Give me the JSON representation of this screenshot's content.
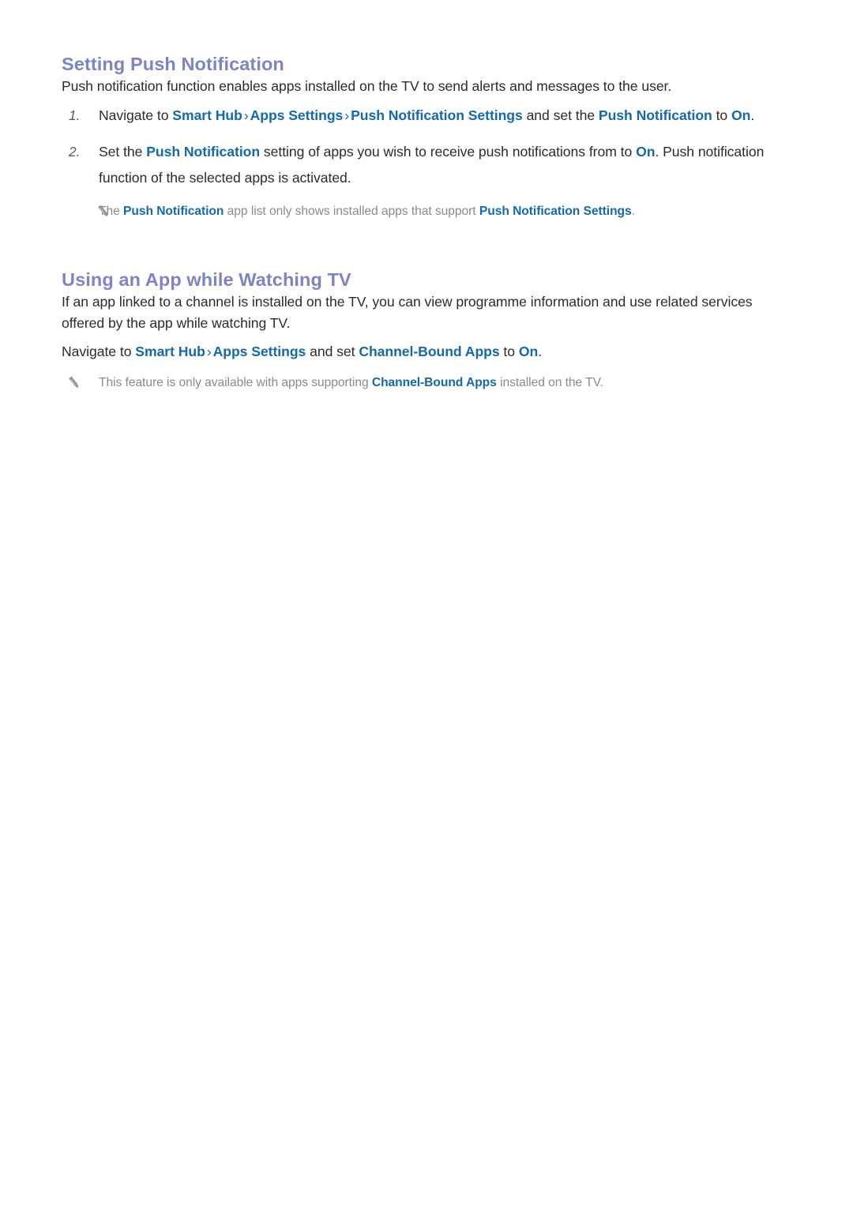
{
  "sections": [
    {
      "id": "setting-push-notification",
      "heading": "Setting Push Notification",
      "intro": "Push notification function enables apps installed on the TV to send alerts and messages to the user.",
      "steps": [
        {
          "marker": "1.",
          "parts": [
            {
              "type": "text",
              "text": "Navigate to "
            },
            {
              "type": "kw",
              "text": "Smart Hub"
            },
            {
              "type": "sep",
              "text": "›"
            },
            {
              "type": "kw",
              "text": "Apps Settings"
            },
            {
              "type": "sep",
              "text": "›"
            },
            {
              "type": "kw",
              "text": "Push Notification Settings"
            },
            {
              "type": "text",
              "text": " and set the "
            },
            {
              "type": "kw",
              "text": "Push Notification"
            },
            {
              "type": "text",
              "text": " to "
            },
            {
              "type": "kw",
              "text": "On"
            },
            {
              "type": "text",
              "text": "."
            }
          ]
        },
        {
          "marker": "2.",
          "parts": [
            {
              "type": "text",
              "text": "Set the "
            },
            {
              "type": "kw",
              "text": "Push Notification"
            },
            {
              "type": "text",
              "text": " setting of apps you wish to receive push notifications from to "
            },
            {
              "type": "kw",
              "text": "On"
            },
            {
              "type": "text",
              "text": ". Push notification function of the selected apps is activated."
            }
          ]
        }
      ],
      "note": {
        "icon": "pencil-icon",
        "parts": [
          {
            "type": "text",
            "text": "The "
          },
          {
            "type": "kw",
            "text": "Push Notification"
          },
          {
            "type": "text",
            "text": " app list only shows installed apps that support "
          },
          {
            "type": "kw",
            "text": "Push Notification Settings"
          },
          {
            "type": "text",
            "text": "."
          }
        ]
      }
    },
    {
      "id": "using-an-app-while-watching-tv",
      "heading": "Using an App while Watching TV",
      "intro": "If an app linked to a channel is installed on the TV, you can view programme information and use related services offered by the app while watching TV.",
      "nav_line": [
        {
          "type": "text",
          "text": "Navigate to "
        },
        {
          "type": "kw",
          "text": "Smart Hub"
        },
        {
          "type": "sep",
          "text": "›"
        },
        {
          "type": "kw",
          "text": "Apps Settings"
        },
        {
          "type": "text",
          "text": " and set "
        },
        {
          "type": "kw",
          "text": "Channel-Bound Apps"
        },
        {
          "type": "text",
          "text": " to "
        },
        {
          "type": "kw",
          "text": "On"
        },
        {
          "type": "text",
          "text": "."
        }
      ],
      "note": {
        "icon": "pencil-icon",
        "parts": [
          {
            "type": "text",
            "text": "This feature is only available with apps supporting "
          },
          {
            "type": "kw",
            "text": "Channel-Bound Apps"
          },
          {
            "type": "text",
            "text": " installed on the TV."
          }
        ]
      }
    }
  ],
  "colors": {
    "heading": "#7e83c6",
    "keyword": "#1468ab",
    "body": "#2b2b2b",
    "note": "#8a8a8a",
    "marker": "#5a5a5a",
    "background": "#ffffff"
  }
}
